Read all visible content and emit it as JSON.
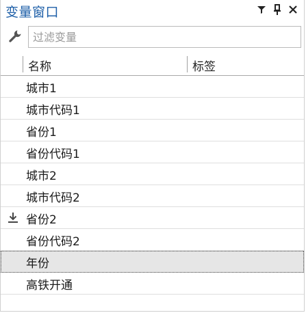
{
  "panel": {
    "title": "变量窗口",
    "buttons": {
      "filter": "filter-icon",
      "pin": "pin-icon",
      "close": "close-icon"
    }
  },
  "filter": {
    "placeholder": "过滤变量",
    "value": ""
  },
  "columns": {
    "name": "名称",
    "label": "标签"
  },
  "variables": [
    {
      "name": "城市1"
    },
    {
      "name": "城市代码1"
    },
    {
      "name": "省份1"
    },
    {
      "name": "省份代码1"
    },
    {
      "name": "城市2"
    },
    {
      "name": "城市代码2"
    },
    {
      "name": "省份2",
      "icon": "download-arrow-icon"
    },
    {
      "name": "省份代码2"
    },
    {
      "name": "年份",
      "selected": true
    },
    {
      "name": "高铁开通"
    }
  ],
  "colors": {
    "title": "#1e5fa8",
    "selected_row": "#e6e6e6"
  }
}
